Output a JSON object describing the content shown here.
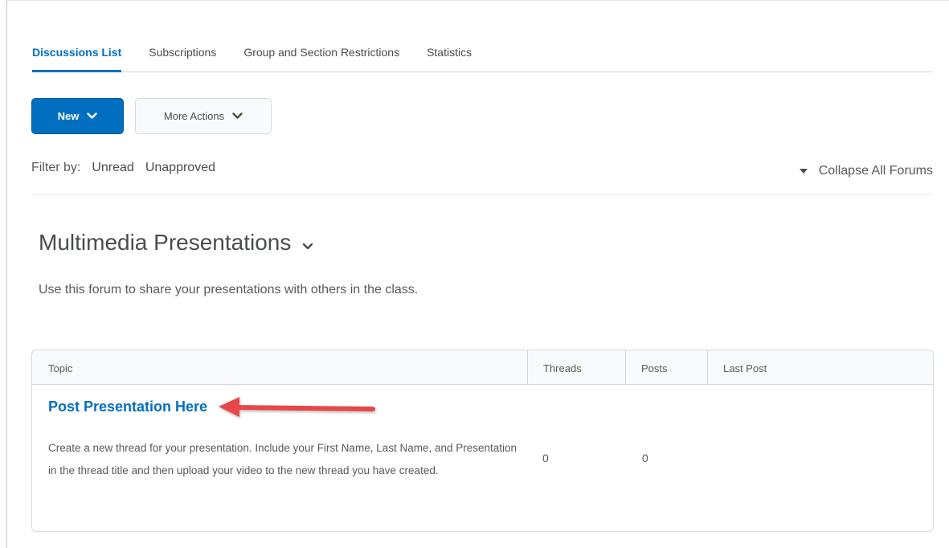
{
  "tabs": [
    {
      "label": "Discussions List",
      "active": true
    },
    {
      "label": "Subscriptions",
      "active": false
    },
    {
      "label": "Group and Section Restrictions",
      "active": false
    },
    {
      "label": "Statistics",
      "active": false
    }
  ],
  "toolbar": {
    "new_label": "New",
    "more_actions_label": "More Actions"
  },
  "filter": {
    "label": "Filter by:",
    "options": [
      "Unread",
      "Unapproved"
    ],
    "collapse_label": "Collapse All Forums"
  },
  "forum": {
    "title": "Multimedia Presentations",
    "description": "Use this forum to share your presentations with others in the class."
  },
  "table": {
    "headers": [
      "Topic",
      "Threads",
      "Posts",
      "Last Post"
    ],
    "rows": [
      {
        "topic": "Post Presentation Here",
        "description": "Create a new thread for your presentation. Include your First Name, Last Name, and Presentation in the thread title and then upload your video to the new thread you have created.",
        "threads": "0",
        "posts": "0",
        "last_post": ""
      }
    ]
  },
  "colors": {
    "primary": "#006fbf",
    "annotation_arrow": "#e8474a"
  },
  "icons": {
    "new_dropdown": "chevron-down-icon",
    "more_actions_dropdown": "chevron-down-icon",
    "collapse": "caret-down-icon",
    "forum_toggle": "chevron-down-icon",
    "annotation": "arrow-left-icon"
  }
}
